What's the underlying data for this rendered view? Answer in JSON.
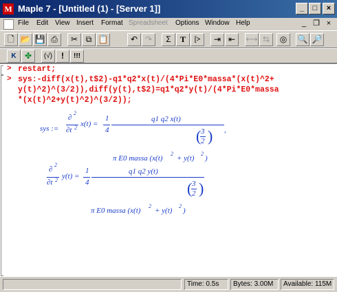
{
  "window": {
    "title": "Maple 7 - [Untitled (1) - [Server 1]]"
  },
  "title_buttons": {
    "minimize": "_",
    "maximize": "□",
    "close": "×"
  },
  "menu": {
    "items": [
      "File",
      "Edit",
      "View",
      "Insert",
      "Format",
      "Spreadsheet",
      "Options",
      "Window",
      "Help"
    ],
    "mdi_minimize": "_",
    "mdi_restore": "❐",
    "mdi_close": "×"
  },
  "toolbar": {
    "new": "🗋",
    "open": "📂",
    "save": "💾",
    "print": "⎙",
    "cut": "✂",
    "copy": "⧉",
    "paste": "📋",
    "undo": "↶",
    "redo": "↷",
    "sigma": "Σ",
    "text": "T",
    "input": "[>",
    "indent": "⇥",
    "outdent": "⇤",
    "execute": "⟷",
    "stop": "⇆",
    "interrupt": "◎",
    "zoom_in": "🔍",
    "zoom_out": "🔎"
  },
  "toolbar2": {
    "k": "K",
    "leaf": "✤",
    "check": "(√)",
    "bang": "!",
    "bangs": "!!!"
  },
  "document": {
    "prompt": ">",
    "input1": "restart;",
    "input2_line1": "sys:-diff(x(t),t$2)-q1*q2*x(t)/(4*Pi*E0*massa*(x(t)^2+",
    "input2_line2": "y(t)^2)^(3/2)),diff(y(t),t$2)=q1*q2*y(t)/(4*Pi*E0*massa",
    "input2_line3": "*(x(t)^2+y(t)^2)^(3/2));"
  },
  "output": {
    "sys": "sys :=",
    "d2": "∂",
    "sq": "2",
    "dt2": "∂t",
    "xt": "x(t) =",
    "yt": "y(t) =",
    "one": "1",
    "four": "4",
    "num1": "q1 q2 x(t)",
    "num2": "q1 q2 y(t)",
    "den": "π E0 massa (x(t)",
    "den_mid": "+ y(t)",
    "den_end": ")",
    "three": "3",
    "two": "2",
    "comma": ","
  },
  "status": {
    "time_label": "Time:",
    "time_value": "0.5s",
    "bytes_label": "Bytes:",
    "bytes_value": "3.00M",
    "avail_label": "Available:",
    "avail_value": "115M"
  }
}
